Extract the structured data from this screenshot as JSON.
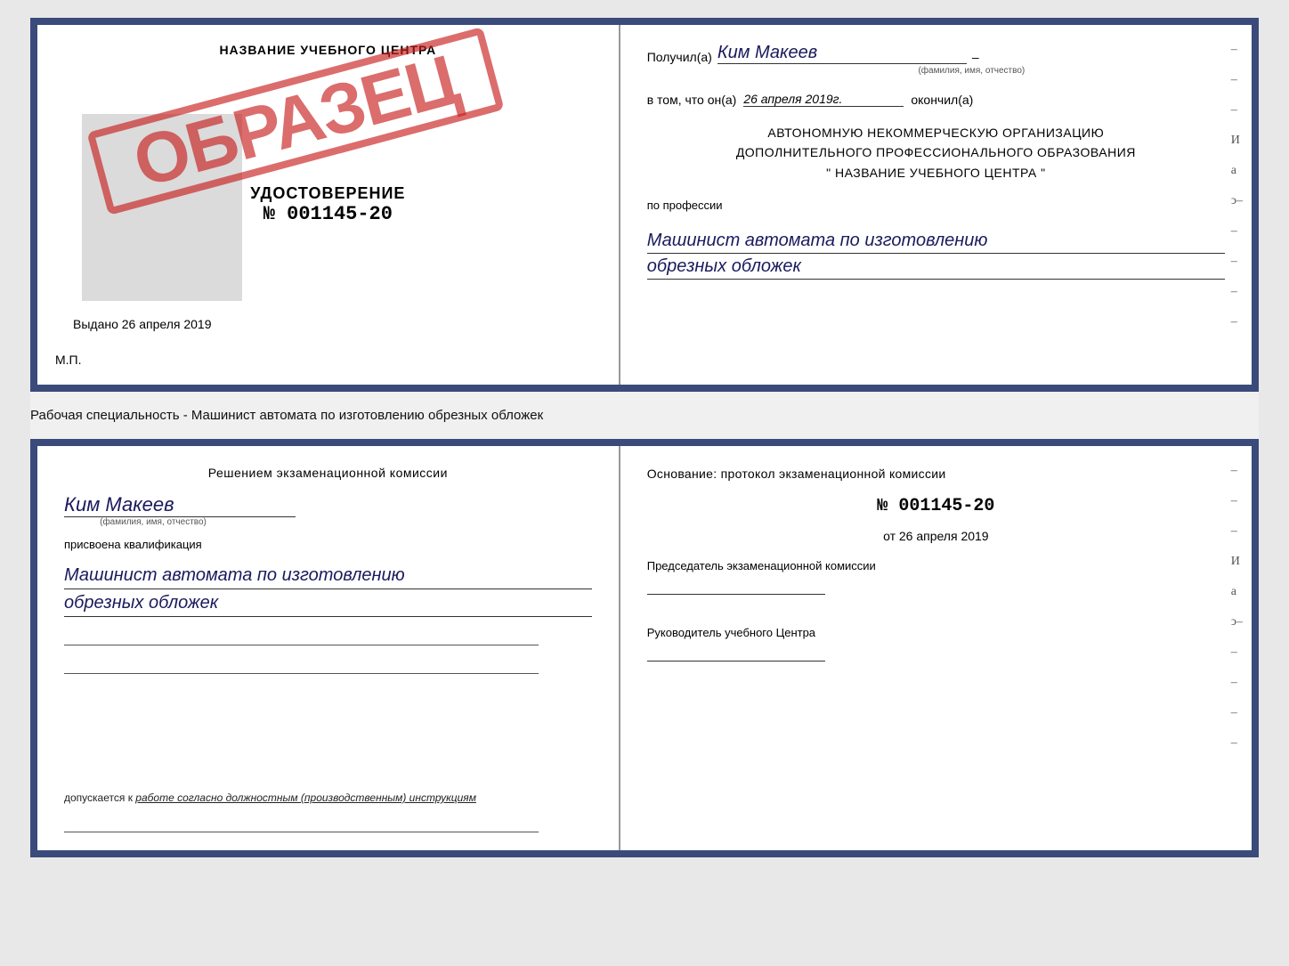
{
  "top_cert": {
    "left": {
      "training_center_title": "НАЗВАНИЕ УЧЕБНОГО ЦЕНТРА",
      "stamp_text": "ОБРАЗЕЦ",
      "udostoverenie_label": "УДОСТОВЕРЕНИЕ",
      "cert_number": "№ 001145-20",
      "vydano_label": "Выдано",
      "vydano_date": "26 апреля 2019",
      "mp_label": "М.П."
    },
    "right": {
      "poluchil_label": "Получил(а)",
      "poluchil_name": "Ким Макеев",
      "fio_sub": "(фамилия, имя, отчество)",
      "vtom_label": "в том, что он(а)",
      "vtom_date": "26 апреля 2019г.",
      "okonchil_label": "окончил(а)",
      "org_line1": "АВТОНОМНУЮ НЕКОММЕРЧЕСКУЮ ОРГАНИЗАЦИЮ",
      "org_line2": "ДОПОЛНИТЕЛЬНОГО ПРОФЕССИОНАЛЬНОГО ОБРАЗОВАНИЯ",
      "org_line3": "\"   НАЗВАНИЕ УЧЕБНОГО ЦЕНТРА   \"",
      "po_professii_label": "по профессии",
      "profession_line1": "Машинист автомата по изготовлению",
      "profession_line2": "обрезных обложек"
    }
  },
  "middle": {
    "label": "Рабочая специальность - Машинист автомата по изготовлению обрезных обложек"
  },
  "bottom_cert": {
    "left": {
      "resheniem_line1": "Решением экзаменационной комиссии",
      "person_name": "Ким Макеев",
      "fio_sub": "(фамилия, имя, отчество)",
      "prisvoena_label": "присвоена квалификация",
      "qualification_line1": "Машинист автомата по изготовлению",
      "qualification_line2": "обрезных обложек",
      "dopuskaetsya_prefix": "допускается к",
      "dopuskaetsya_italic": "работе согласно должностным (производственным) инструкциям"
    },
    "right": {
      "osnovanie_label": "Основание: протокол экзаменационной комиссии",
      "protocol_number": "№ 001145-20",
      "protocol_date_prefix": "от",
      "protocol_date": "26 апреля 2019",
      "predsedatel_label": "Председатель экзаменационной комиссии",
      "rukovoditel_label": "Руководитель учебного Центра"
    }
  }
}
